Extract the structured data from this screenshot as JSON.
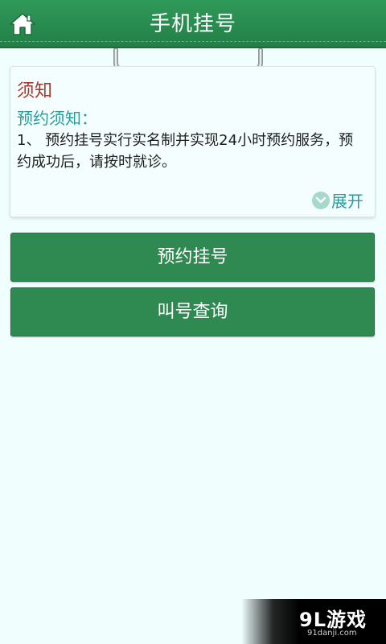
{
  "header": {
    "title": "手机挂号",
    "home_icon": "home-icon"
  },
  "notice": {
    "title": "须知",
    "subtitle": "预约须知：",
    "body": "1、 预约挂号实行实名制并实现24小时预约服务，预约成功后，请按时就诊。",
    "expand_label": "展开",
    "expand_icon": "chevron-down-icon"
  },
  "actions": {
    "appointment_label": "预约挂号",
    "queue_label": "叫号查询"
  },
  "watermark": {
    "logo": "9L游戏",
    "url": "91danji.com"
  },
  "colors": {
    "header_green": "#2f9a5a",
    "button_green": "#2f8a51",
    "notice_title_red": "#a53a2c",
    "notice_teal": "#2a9a9a",
    "background": "#f0fffe"
  }
}
